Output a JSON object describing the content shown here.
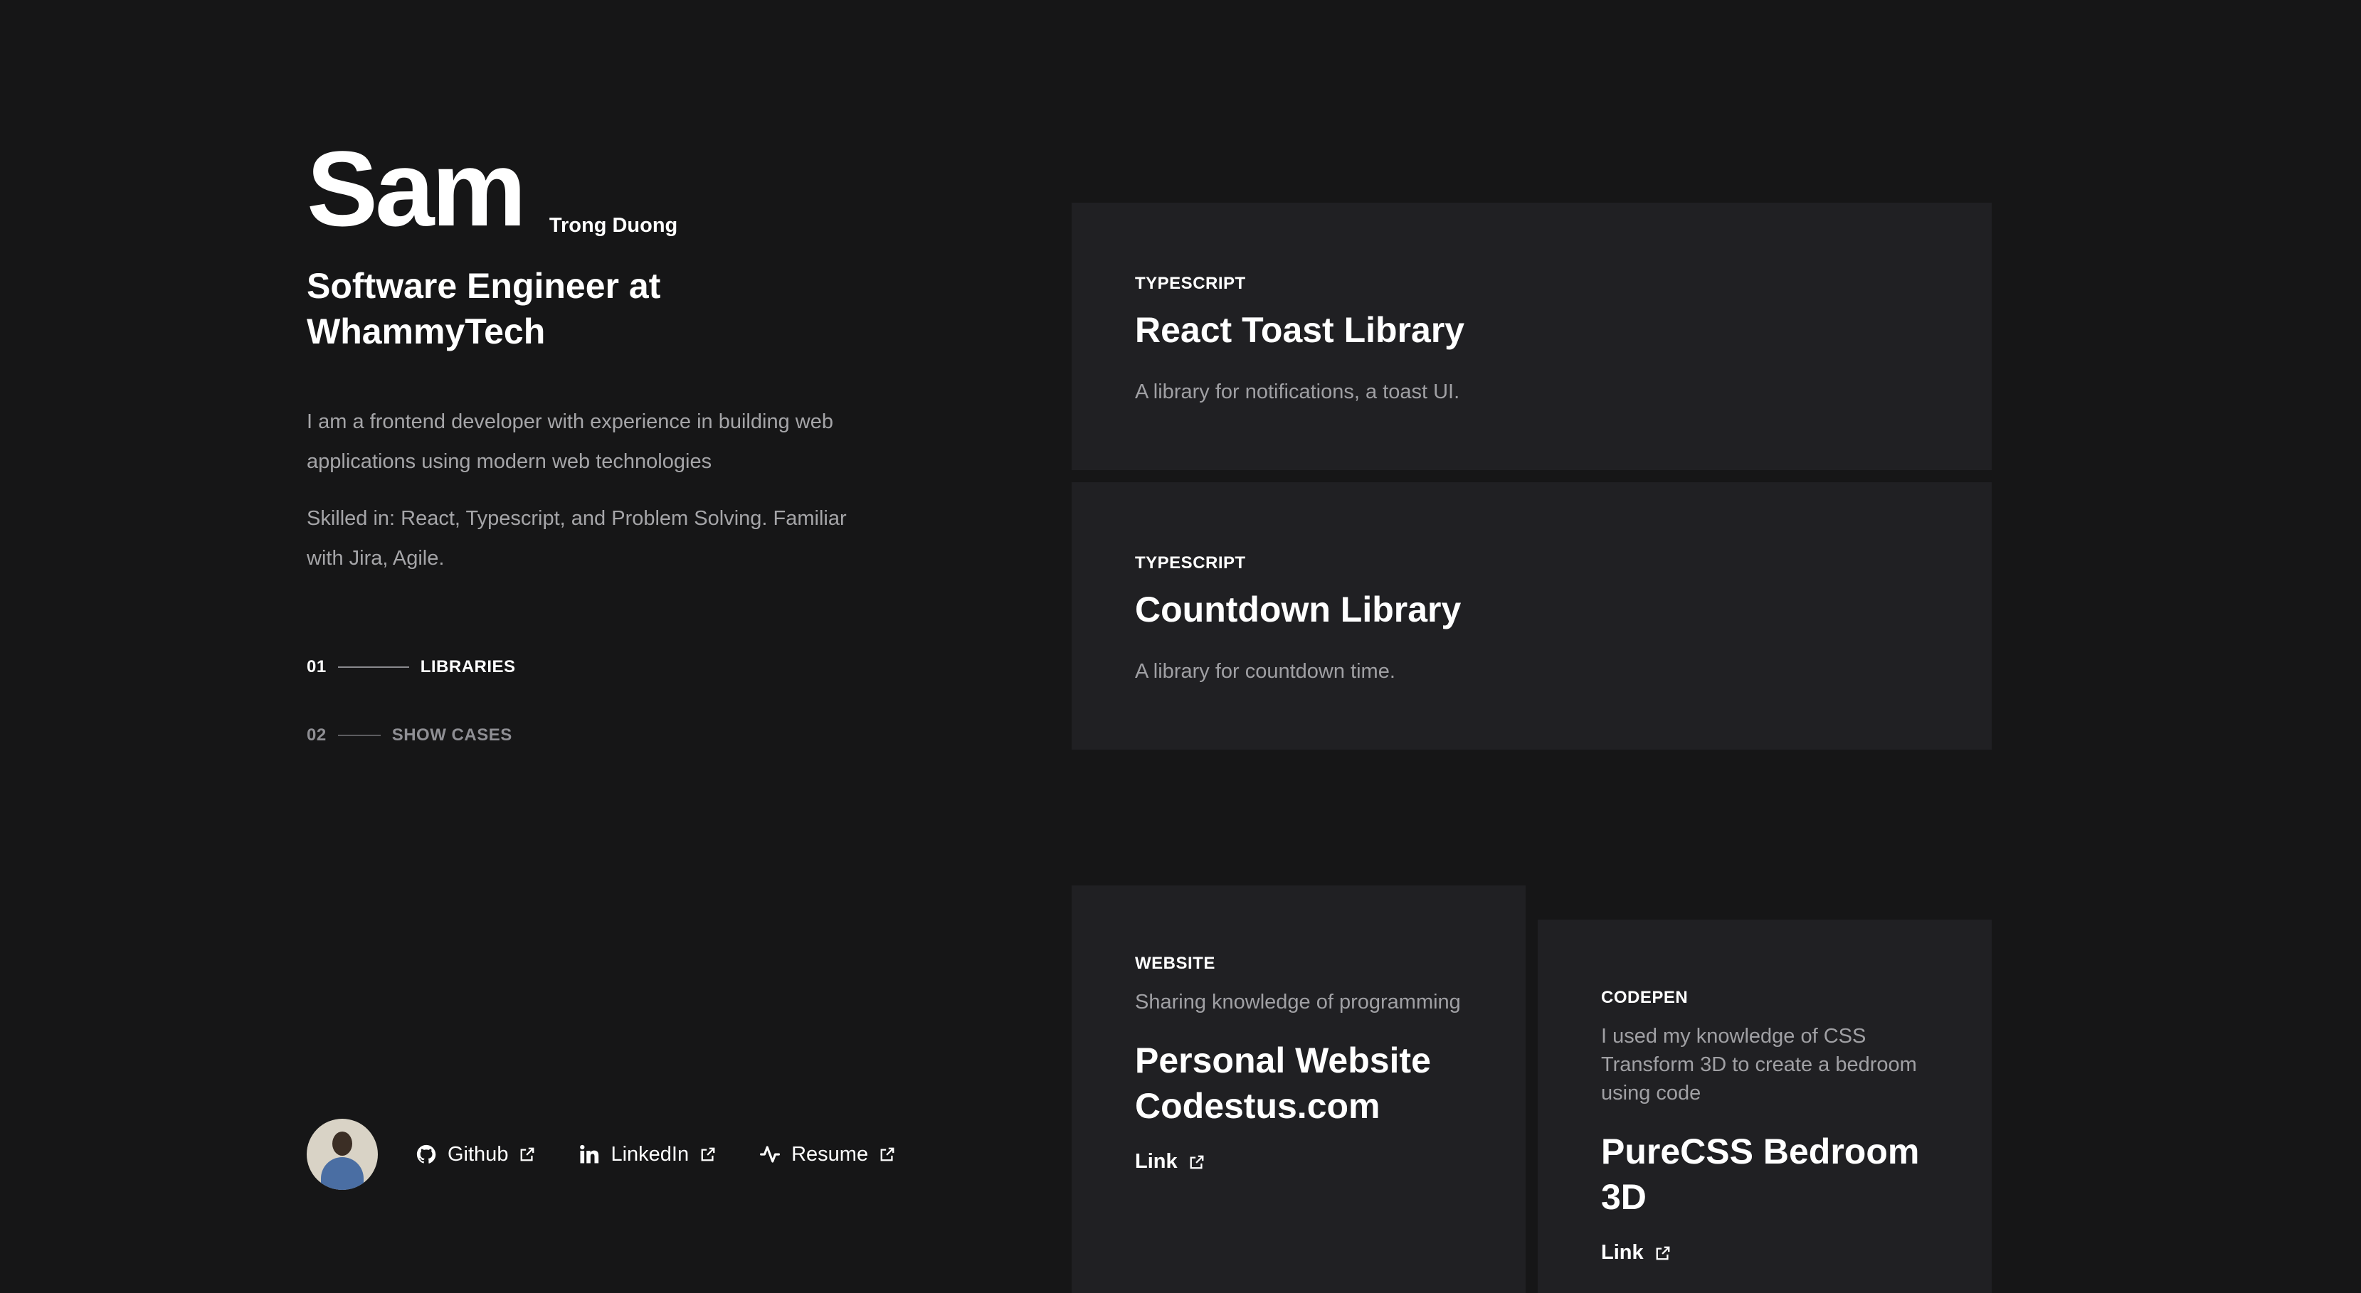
{
  "profile": {
    "name": "Sam",
    "full_name": "Trong Duong",
    "role": "Software Engineer at WhammyTech",
    "description_1": "I am a frontend developer with experience in building web applications using modern web technologies",
    "description_2": "Skilled in: React, Typescript, and Problem Solving. Familiar with Jira, Agile."
  },
  "nav": [
    {
      "number": "01",
      "label": "LIBRARIES"
    },
    {
      "number": "02",
      "label": "SHOW CASES"
    }
  ],
  "social": [
    {
      "label": "Github",
      "icon": "github-icon"
    },
    {
      "label": "LinkedIn",
      "icon": "linkedin-icon"
    },
    {
      "label": "Resume",
      "icon": "activity-icon"
    }
  ],
  "libraries": [
    {
      "tag": "TYPESCRIPT",
      "title": "React Toast Library",
      "description": "A library for notifications, a toast UI."
    },
    {
      "tag": "TYPESCRIPT",
      "title": "Countdown Library",
      "description": "A library for countdown time."
    }
  ],
  "showcases": [
    {
      "tag": "WEBSITE",
      "description": "Sharing knowledge of programming",
      "title": "Personal Website Codestus.com",
      "link_label": "Link"
    },
    {
      "tag": "CODEPEN",
      "description": "I used my knowledge of CSS Transform 3D to create a bedroom using code",
      "title": "PureCSS Bedroom 3D",
      "link_label": "Link"
    }
  ],
  "colors": {
    "background": "#161617",
    "card": "#202023",
    "muted_text": "#a0a0a4",
    "text": "#ffffff"
  }
}
